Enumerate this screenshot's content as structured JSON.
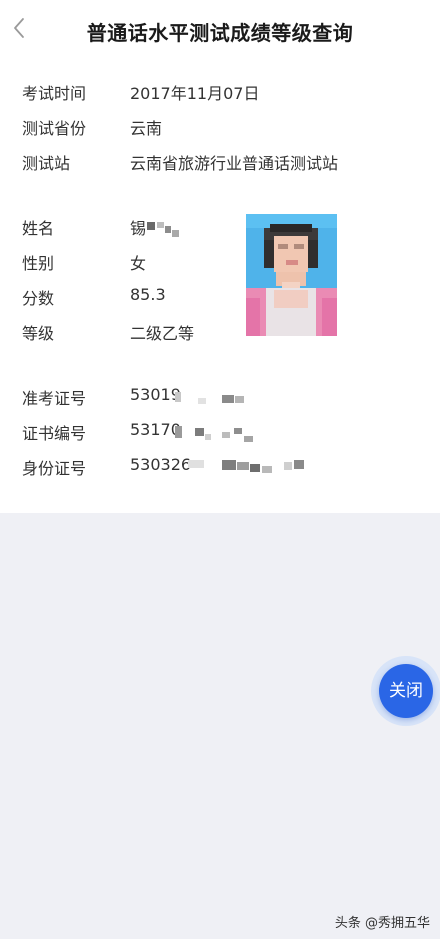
{
  "header": {
    "title": "普通话水平测试成绩等级查询",
    "back_icon": "chevron-left-icon"
  },
  "exam": {
    "time_label": "考试时间",
    "time_value": "2017年11月07日",
    "province_label": "测试省份",
    "province_value": "云南",
    "station_label": "测试站",
    "station_value": "云南省旅游行业普通话测试站"
  },
  "person": {
    "name_label": "姓名",
    "name_value": "锡",
    "gender_label": "性别",
    "gender_value": "女",
    "score_label": "分数",
    "score_value": "85.3",
    "level_label": "等级",
    "level_value": "二级乙等"
  },
  "ids": {
    "admission_label": "准考证号",
    "admission_value": "53019",
    "certificate_label": "证书编号",
    "certificate_value": "53170",
    "idcard_label": "身份证号",
    "idcard_value": "530326"
  },
  "close_button": {
    "label": "关闭"
  },
  "watermark": {
    "text": "头条 @秀拥五华"
  },
  "colors": {
    "accent": "#2a66e6",
    "background": "#eff0f5"
  }
}
